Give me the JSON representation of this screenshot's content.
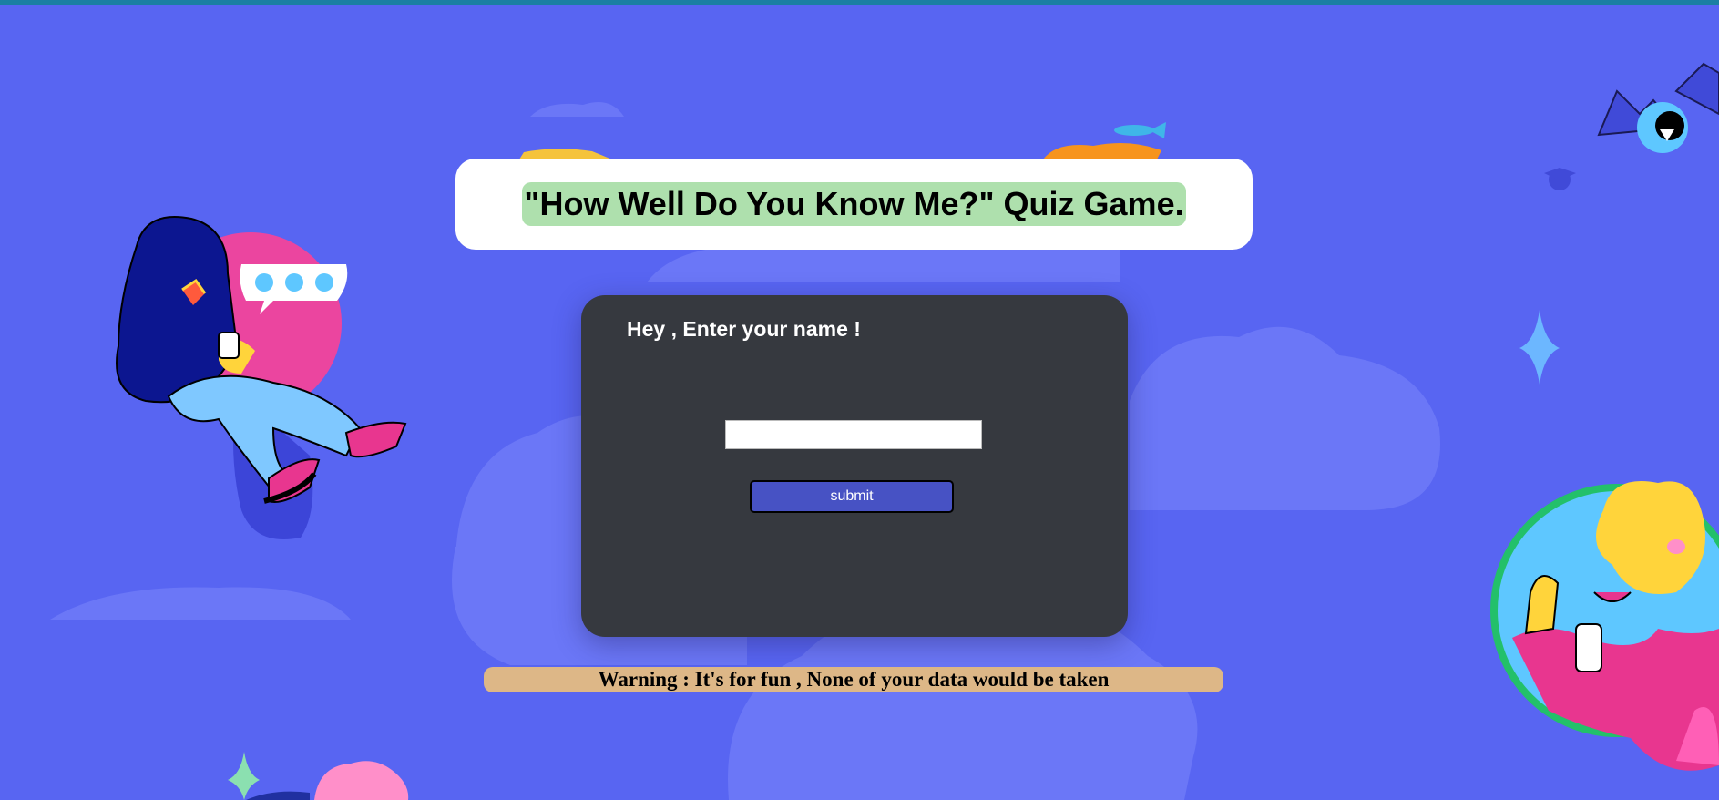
{
  "title": "\"How Well Do You Know Me?\" Quiz Game.",
  "form": {
    "prompt": "Hey , Enter your name !",
    "name_value": "",
    "submit_label": "submit"
  },
  "warning": "Warning : It's for fun , None of your data would be taken",
  "colors": {
    "background": "#5865f2",
    "panel": "#36393f",
    "title_highlight": "#aee0ad",
    "button": "#4752c4",
    "warning_bg": "#ddb787"
  }
}
